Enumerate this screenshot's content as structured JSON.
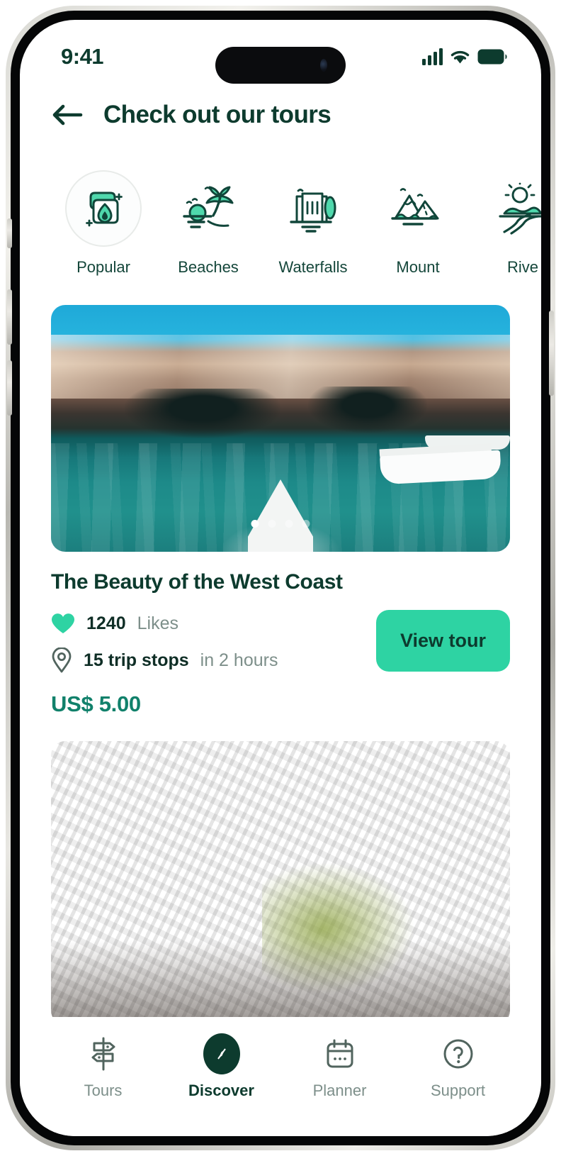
{
  "status_bar": {
    "time": "9:41",
    "cellular_icon": "cellular-signal-icon",
    "wifi_icon": "wifi-icon",
    "battery_icon": "battery-full-icon"
  },
  "header": {
    "back_icon": "arrow-left-icon",
    "title": "Check out our tours"
  },
  "categories": [
    {
      "label": "Popular",
      "icon": "popular-fire-icon",
      "active": true
    },
    {
      "label": "Beaches",
      "icon": "beach-palm-icon",
      "active": false
    },
    {
      "label": "Waterfalls",
      "icon": "waterfall-icon",
      "active": false
    },
    {
      "label": "Mount",
      "icon": "mountain-icon",
      "active": false
    },
    {
      "label": "Rive",
      "icon": "river-sunrise-icon",
      "active": false
    }
  ],
  "tours": [
    {
      "title": "The Beauty of the West Coast",
      "likes_icon": "heart-filled-icon",
      "likes_count": "1240",
      "likes_label": "Likes",
      "stops_icon": "map-pin-icon",
      "stops_text": "15 trip stops",
      "duration_text": "in 2 hours",
      "cta_label": "View tour",
      "price": "US$ 5.00",
      "carousel": {
        "total_dots": 4,
        "active_index": 0
      }
    },
    {
      "title": "",
      "carousel": {
        "total_dots": 0,
        "active_index": 0
      }
    }
  ],
  "bottom_nav": [
    {
      "label": "Tours",
      "icon": "signpost-icon",
      "active": false
    },
    {
      "label": "Discover",
      "icon": "compass-icon",
      "active": true
    },
    {
      "label": "Planner",
      "icon": "calendar-icon",
      "active": false
    },
    {
      "label": "Support",
      "icon": "question-mark-icon",
      "active": false
    }
  ],
  "colors": {
    "brand_dark": "#0d3b2e",
    "brand_green": "#2ed3a3",
    "price_green": "#11816b",
    "muted_text": "#7d8f8a"
  }
}
